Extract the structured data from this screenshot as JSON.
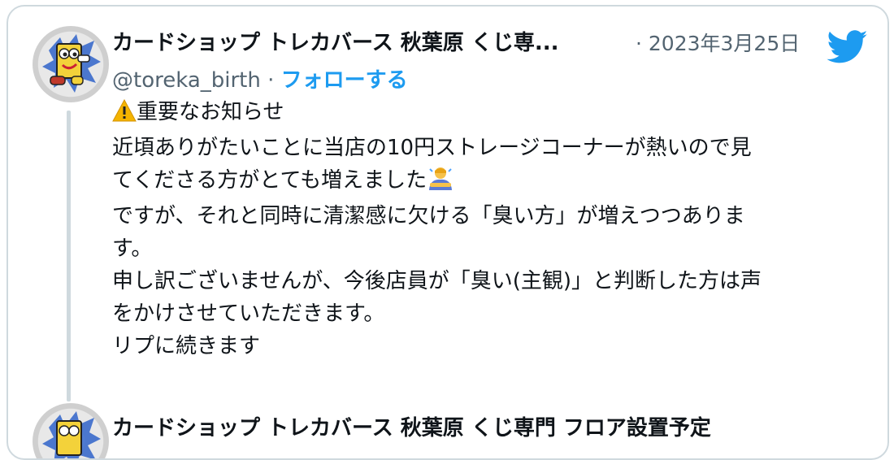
{
  "tweet": {
    "display_name": "カードショップ トレカバース 秋葉原 くじ専...",
    "date": "· 2023年3月25日",
    "handle": "@toreka_birth",
    "separator": " · ",
    "follow_label": "フォローする",
    "lines": [
      "重要なお知らせ",
      "近頃ありがたいことに当店の10円ストレージコーナーが熱いので見",
      "てくださる方がとても増えました",
      "ですが、それと同時に清潔感に欠ける「臭い方」が増えつつありま",
      "す。",
      "",
      "申し訳ございませんが、今後店員が「臭い(主観)」と判断した方は声",
      "をかけさせていただきます。",
      "リプに続きます"
    ]
  },
  "next_tweet": {
    "display_name": "カードショップ トレカバース 秋葉原 くじ専門 フロア設置予定"
  },
  "icons": {
    "platform": "twitter-bird-icon",
    "warning": "warning-icon",
    "bowing": "bowing-person-icon"
  },
  "colors": {
    "accent": "#1d9bf0",
    "text": "#0f1419",
    "muted": "#536471",
    "border": "#cfd9de"
  }
}
